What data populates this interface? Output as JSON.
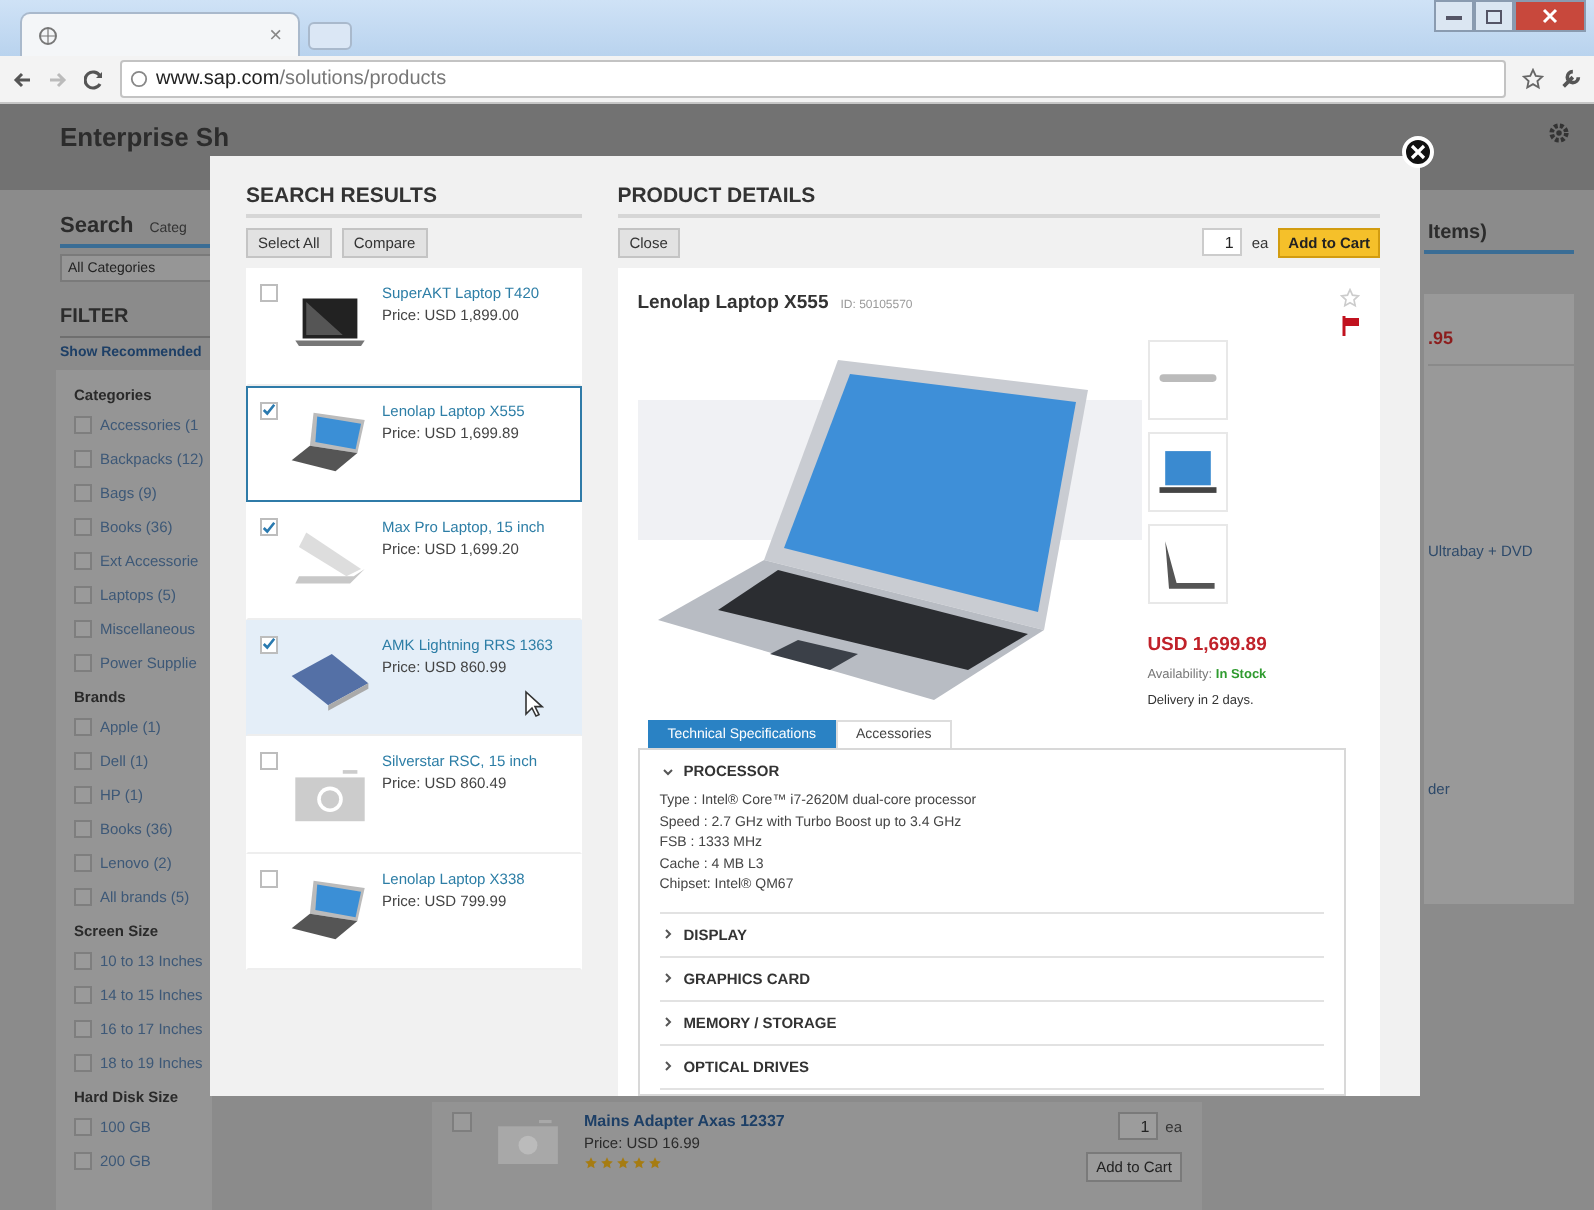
{
  "browser": {
    "tab_close": "×",
    "url": "**www.sap.com**/solutions/products"
  },
  "background": {
    "header_title": "Enterprise Sh",
    "search_tab": "Search",
    "category_tab": "Categ",
    "category_select": "All Categories",
    "filter_title": "FILTER",
    "show_recommended": "Show Recommended",
    "filter_groups": [
      {
        "title": "Categories",
        "options": [
          {
            "label": "Accessories (1",
            "checked": false
          },
          {
            "label": "Backpacks (12)",
            "checked": false
          },
          {
            "label": "Bags (9)",
            "checked": false
          },
          {
            "label": "Books (36)",
            "checked": false
          },
          {
            "label": "Ext Accessorie",
            "checked": false
          },
          {
            "label": "Laptops (5)",
            "checked": false
          },
          {
            "label": "Miscellaneous",
            "checked": false
          },
          {
            "label": "Power Supplie",
            "checked": false
          }
        ]
      },
      {
        "title": "Brands",
        "options": [
          {
            "label": "Apple (1)",
            "checked": false
          },
          {
            "label": "Dell (1)",
            "checked": false
          },
          {
            "label": "HP (1)",
            "checked": false
          },
          {
            "label": "Books (36)",
            "checked": false
          },
          {
            "label": "Lenovo (2)",
            "checked": false
          },
          {
            "label": "All brands (5)",
            "checked": false
          }
        ]
      },
      {
        "title": "Screen Size",
        "options": [
          {
            "label": "10 to 13 Inches",
            "checked": false
          },
          {
            "label": "14 to 15 Inches",
            "checked": false
          },
          {
            "label": "16 to 17 Inches",
            "checked": false
          },
          {
            "label": "18 to 19 Inches",
            "checked": false
          }
        ]
      },
      {
        "title": "Hard Disk Size",
        "options": [
          {
            "label": "100 GB",
            "checked": false
          },
          {
            "label": "200 GB",
            "checked": false
          }
        ]
      }
    ],
    "cart_title": "Items)",
    "cart_price": ".95",
    "cart_line_1": "Ultrabay + DVD",
    "cart_line_2": "der",
    "bottom_item": {
      "name": "Mains Adapter Axas 12337",
      "price": "Price: USD 16.99",
      "stars": 5,
      "checked": false,
      "quantity": "1",
      "unit": "ea",
      "button": "Add to Cart"
    }
  },
  "modal": {
    "search_results": {
      "title": "SEARCH RESULTS",
      "buttons": [
        "Select All",
        "Compare"
      ],
      "items": [
        {
          "name": "SuperAKT Laptop T420",
          "price": "Price: USD 1,899.00",
          "checked": false,
          "selected": false,
          "highlighted": false,
          "kind": "laptop-black"
        },
        {
          "name": "Lenolap Laptop X555",
          "price": "Price: USD 1,699.89",
          "checked": true,
          "selected": true,
          "highlighted": false,
          "kind": "laptop-blue"
        },
        {
          "name": "Max Pro Laptop, 15 inch",
          "price": "Price: USD 1,699.20",
          "checked": true,
          "selected": false,
          "highlighted": false,
          "kind": "laptop-silver"
        },
        {
          "name": "AMK Lightning RRS 1363",
          "price": "Price: USD 860.99",
          "checked": true,
          "selected": false,
          "highlighted": true,
          "kind": "laptop-closed"
        },
        {
          "name": "Silverstar RSC, 15 inch",
          "price": "Price: USD 860.49",
          "checked": false,
          "selected": false,
          "highlighted": false,
          "kind": "camera"
        },
        {
          "name": "Lenolap Laptop X338",
          "price": "Price: USD 799.99",
          "checked": false,
          "selected": false,
          "highlighted": false,
          "kind": "laptop-blue"
        }
      ]
    },
    "product_details": {
      "title": "PRODUCT DETAILS",
      "close_button": "Close",
      "quantity": "1",
      "unit": "ea",
      "add_button": "Add to Cart",
      "product": {
        "name": "Lenolap Laptop X555",
        "id": "ID: 50105570",
        "favorite": false,
        "flagged": true,
        "price": "USD 1,699.89",
        "availability": "Availability: **In Stock**",
        "delivery": "Delivery in 2 days."
      },
      "tabs": [
        {
          "label": "Technical Specifications",
          "selected": true
        },
        {
          "label": "Accessories",
          "selected": false
        }
      ],
      "sections": [
        {
          "title": "PROCESSOR",
          "expanded": true,
          "lines": [
            "Type : Intel® Core™ i7-2620M dual-core processor",
            "Speed : 2.7 GHz with Turbo Boost up to 3.4 GHz",
            "FSB : 1333 MHz",
            "Cache : 4 MB L3",
            "Chipset: Intel® QM67"
          ]
        },
        {
          "title": "DISPLAY",
          "expanded": false
        },
        {
          "title": "GRAPHICS CARD",
          "expanded": false
        },
        {
          "title": "MEMORY / STORAGE",
          "expanded": false
        },
        {
          "title": "OPTICAL DRIVES",
          "expanded": false
        }
      ]
    }
  }
}
